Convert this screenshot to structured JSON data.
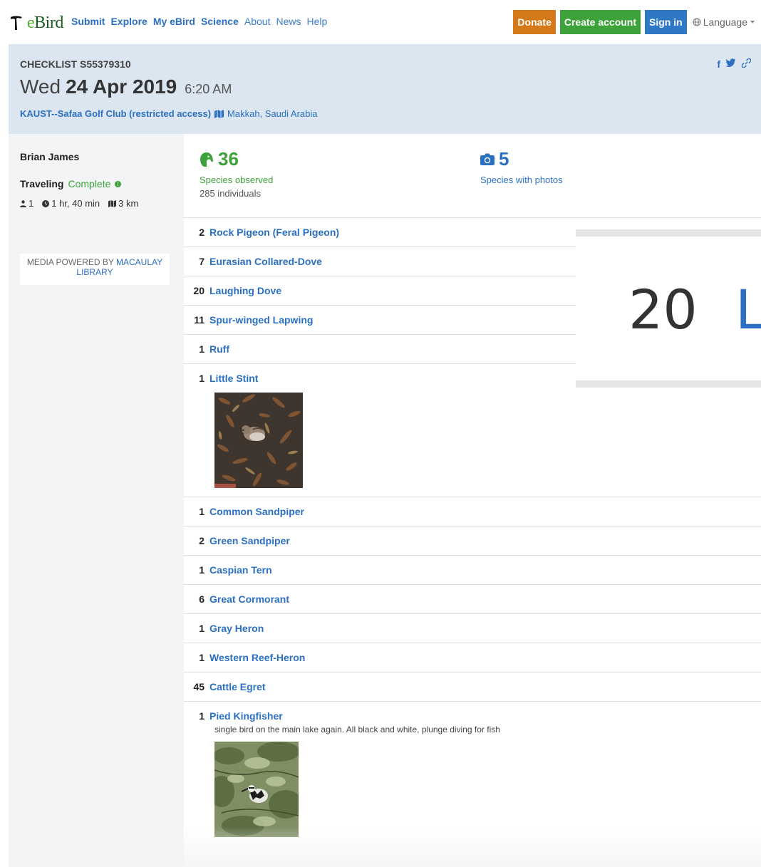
{
  "nav": {
    "brand": "eBird",
    "links": [
      "Submit",
      "Explore",
      "My eBird",
      "Science",
      "About",
      "News",
      "Help"
    ],
    "donate": "Donate",
    "create_account": "Create account",
    "sign_in": "Sign in",
    "language": "Language"
  },
  "checklist": {
    "id_label": "CHECKLIST S55379310",
    "weekday": "Wed",
    "date": "24 Apr 2019",
    "time": "6:20 AM",
    "location": "KAUST--Safaa Golf Club (restricted access)",
    "region": "Makkah, Saudi Arabia"
  },
  "share": {
    "facebook": "f",
    "twitter": "twitter",
    "link": "link"
  },
  "sidebar": {
    "observer": "Brian James",
    "protocol": "Traveling",
    "status": "Complete",
    "observers_count": "1",
    "duration": "1 hr, 40 min",
    "distance": "3 km",
    "media_powered": "MEDIA POWERED BY",
    "macaulay": "MACAULAY LIBRARY"
  },
  "summary": {
    "species_count": "36",
    "species_label": "Species observed",
    "individuals": "285 individuals",
    "photos_count": "5",
    "photos_label": "Species with photos"
  },
  "species": [
    {
      "count": "2",
      "name": "Rock Pigeon (Feral Pigeon)"
    },
    {
      "count": "7",
      "name": "Eurasian Collared-Dove"
    },
    {
      "count": "20",
      "name": "Laughing Dove"
    },
    {
      "count": "11",
      "name": "Spur-winged Lapwing"
    },
    {
      "count": "1",
      "name": "Ruff"
    },
    {
      "count": "1",
      "name": "Little Stint"
    },
    {
      "count": "1",
      "name": "Common Sandpiper"
    },
    {
      "count": "2",
      "name": "Green Sandpiper"
    },
    {
      "count": "1",
      "name": "Caspian Tern"
    },
    {
      "count": "6",
      "name": "Great Cormorant"
    },
    {
      "count": "1",
      "name": "Gray Heron"
    },
    {
      "count": "1",
      "name": "Western Reef-Heron"
    },
    {
      "count": "45",
      "name": "Cattle Egret"
    },
    {
      "count": "1",
      "name": "Pied Kingfisher",
      "comment": "single bird on the main lake again. All black and white, plunge diving for fish"
    }
  ],
  "zoom": {
    "count": "20",
    "letter": "L"
  },
  "colors": {
    "link": "#2b70c2",
    "green": "#3da23a",
    "donate": "#d4781a",
    "header_bg": "#dce6f0"
  }
}
